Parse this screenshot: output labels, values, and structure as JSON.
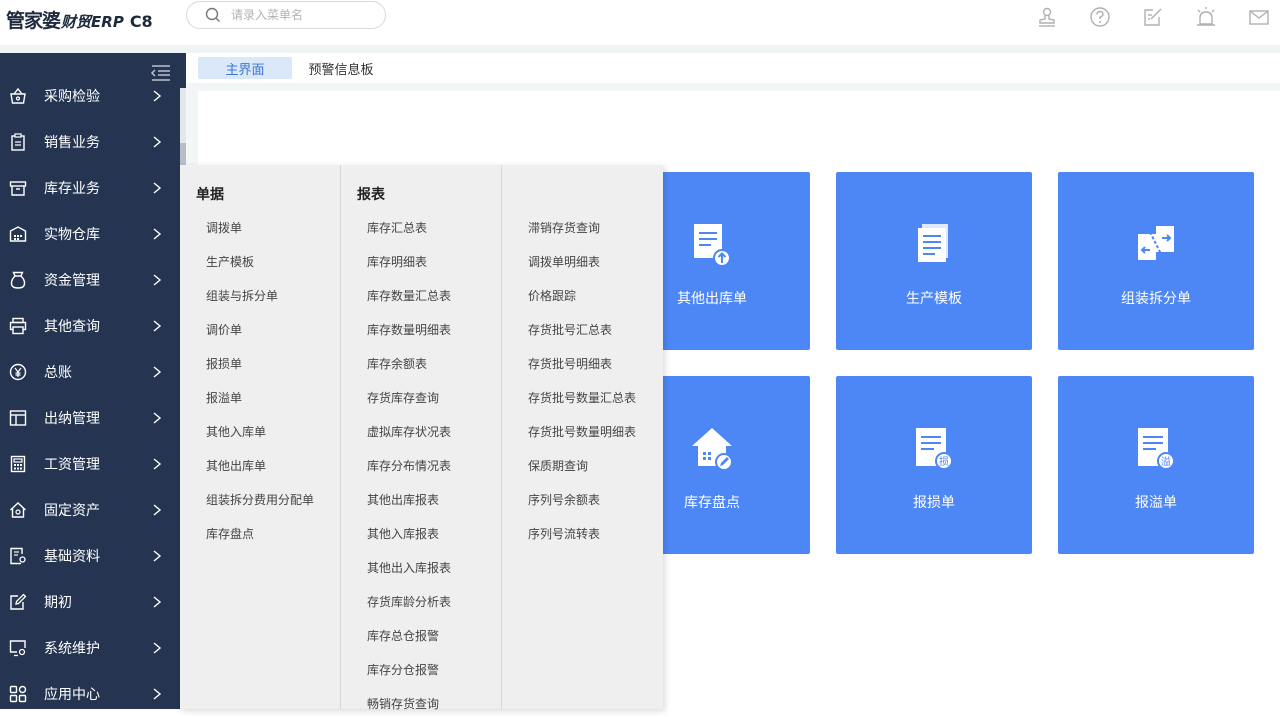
{
  "logo": {
    "brand": "管家婆",
    "product": "财贸ERP",
    "edition": "C8"
  },
  "search": {
    "placeholder": "请录入菜单名",
    "icon": "search-icon"
  },
  "top_icons": [
    "stamp-icon",
    "help-icon",
    "edit-icon",
    "alarm-icon",
    "mail-icon"
  ],
  "colors": {
    "sidebar": "#253551",
    "tile": "#4d87f6",
    "active_tab_bg": "#dbe8fa",
    "active_tab_text": "#3a76d8",
    "menu_bg": "#efefef"
  },
  "sidebar": {
    "items": [
      {
        "label": "采购检验",
        "icon": "shopping-basket-icon"
      },
      {
        "label": "销售业务",
        "icon": "clipboard-icon"
      },
      {
        "label": "库存业务",
        "icon": "inventory-box-icon"
      },
      {
        "label": "实物仓库",
        "icon": "warehouse-icon"
      },
      {
        "label": "资金管理",
        "icon": "money-bag-icon"
      },
      {
        "label": "其他查询",
        "icon": "printer-icon"
      },
      {
        "label": "总账",
        "icon": "yen-circle-icon"
      },
      {
        "label": "出纳管理",
        "icon": "layout-icon"
      },
      {
        "label": "工资管理",
        "icon": "calculator-icon"
      },
      {
        "label": "固定资产",
        "icon": "house-icon"
      },
      {
        "label": "基础资料",
        "icon": "document-settings-icon"
      },
      {
        "label": "期初",
        "icon": "edit-box-icon"
      },
      {
        "label": "系统维护",
        "icon": "monitor-settings-icon"
      },
      {
        "label": "应用中心",
        "icon": "apps-grid-icon"
      }
    ]
  },
  "tabs": [
    {
      "label": "主界面",
      "active": true
    },
    {
      "label": "预警信息板",
      "active": false
    }
  ],
  "tiles": [
    {
      "label": "其他出库单",
      "icon": "doc-upload-icon"
    },
    {
      "label": "生产模板",
      "icon": "doc-stack-icon"
    },
    {
      "label": "组装拆分单",
      "icon": "split-docs-icon"
    },
    {
      "label": "库存盘点",
      "icon": "house-edit-icon"
    },
    {
      "label": "报损单",
      "icon": "doc-loss-icon",
      "badge": "损"
    },
    {
      "label": "报溢单",
      "icon": "doc-overflow-icon",
      "badge": "溢"
    }
  ],
  "menu": {
    "col1": {
      "title": "单据",
      "items": [
        "调拨单",
        "生产模板",
        "组装与拆分单",
        "调价单",
        "报损单",
        "报溢单",
        "其他入库单",
        "其他出库单",
        "组装拆分费用分配单",
        "库存盘点"
      ]
    },
    "col2": {
      "title": "报表",
      "items": [
        "库存汇总表",
        "库存明细表",
        "库存数量汇总表",
        "库存数量明细表",
        "库存余额表",
        "存货库存查询",
        "虚拟库存状况表",
        "库存分布情况表",
        "其他出库报表",
        "其他入库报表",
        "其他出入库报表",
        "存货库龄分析表",
        "库存总仓报警",
        "库存分仓报警",
        "畅销存货查询"
      ]
    },
    "col3": {
      "title": "",
      "items": [
        "滞销存货查询",
        "调拨单明细表",
        "价格跟踪",
        "存货批号汇总表",
        "存货批号明细表",
        "存货批号数量汇总表",
        "存货批号数量明细表",
        "保质期查询",
        "序列号余额表",
        "序列号流转表"
      ]
    }
  }
}
